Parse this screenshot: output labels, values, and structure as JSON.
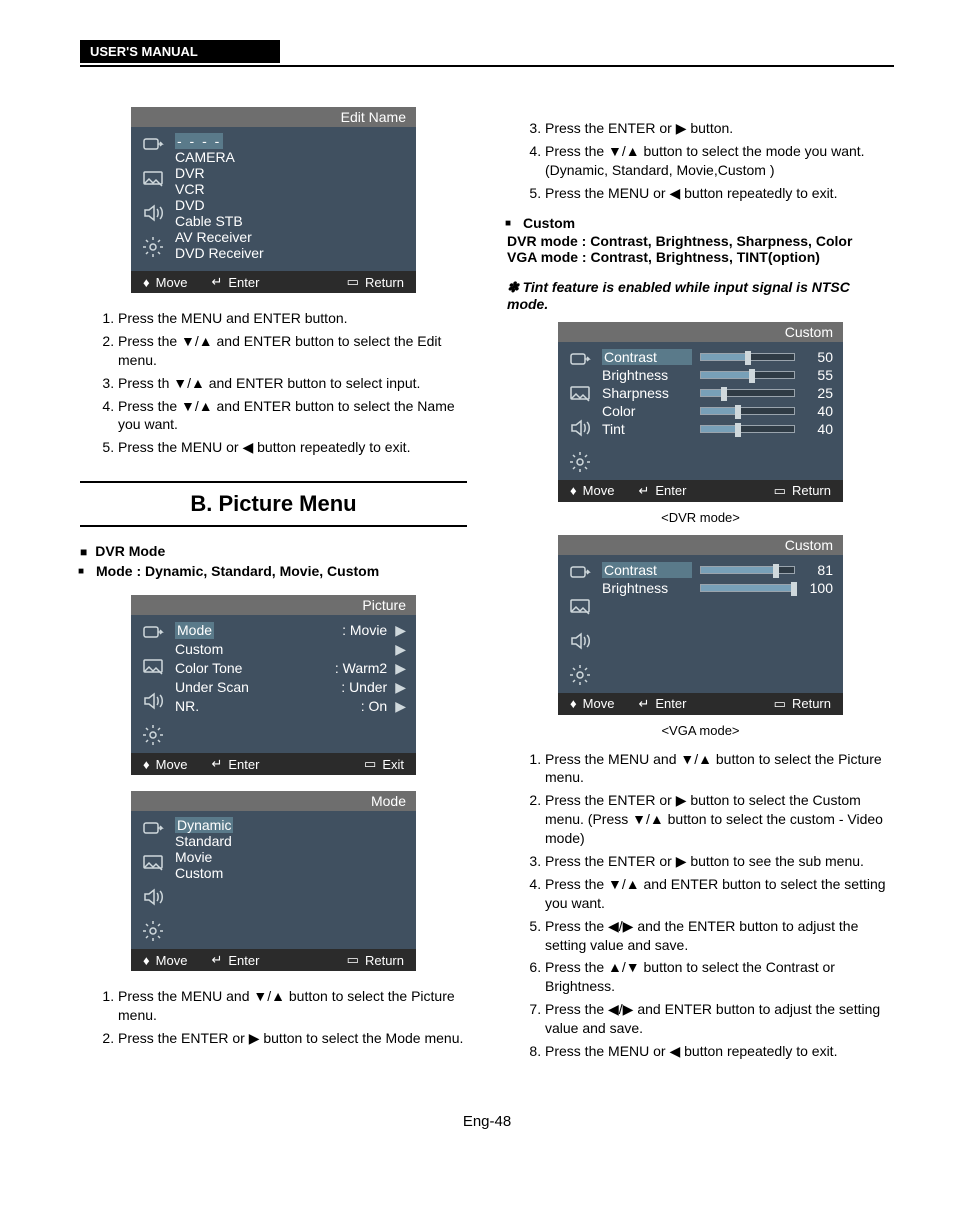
{
  "header": {
    "title": "USER'S MANUAL"
  },
  "osd_edit": {
    "title": "Edit Name",
    "dashes": "- - - -",
    "items": [
      "CAMERA",
      "DVR",
      "VCR",
      "DVD",
      "Cable STB",
      "AV Receiver",
      "DVD Receiver"
    ],
    "foot_move": "Move",
    "foot_enter": "Enter",
    "foot_return": "Return"
  },
  "steps_edit": [
    "Press the MENU and ENTER button.",
    "Press the ▼/▲ and ENTER button to select the Edit menu.",
    "Press th ▼/▲ and ENTER button to select input.",
    "Press the ▼/▲ and ENTER button to select the Name you want.",
    "Press the MENU or ◀ button repeatedly to exit."
  ],
  "section_b": "B. Picture Menu",
  "dvr_mode_hd": "DVR Mode",
  "mode_line": "Mode : Dynamic, Standard, Movie,  Custom",
  "osd_picture": {
    "title": "Picture",
    "rows": [
      {
        "lbl": "Mode",
        "val": ": Movie",
        "arr": "▶"
      },
      {
        "lbl": "Custom",
        "val": "",
        "arr": "▶"
      },
      {
        "lbl": "Color Tone",
        "val": ": Warm2",
        "arr": "▶"
      },
      {
        "lbl": "Under Scan",
        "val": ": Under",
        "arr": "▶"
      },
      {
        "lbl": "NR.",
        "val": ": On",
        "arr": "▶"
      }
    ],
    "foot_move": "Move",
    "foot_enter": "Enter",
    "foot_exit": "Exit"
  },
  "osd_mode": {
    "title": "Mode",
    "items": [
      "Dynamic",
      "Standard",
      "Movie",
      "Custom"
    ],
    "highlight_index": 0,
    "foot_move": "Move",
    "foot_enter": "Enter",
    "foot_return": "Return"
  },
  "steps_mode": [
    "Press the MENU and ▼/▲ button to select the Picture menu.",
    "Press  the ENTER or ▶ button to select the Mode menu."
  ],
  "right_top_steps": [
    "Press  the ENTER or ▶ button.",
    "Press the ▼/▲ button to select the mode you want. (Dynamic, Standard, Movie,Custom )",
    "Press the MENU or ◀ button repeatedly to exit."
  ],
  "custom_hd": "Custom",
  "dvr_line": "DVR mode : Contrast, Brightness, Sharpness, Color",
  "vga_line": "VGA mode   : Contrast, Brightness, TINT(option)",
  "tint_note": "✽ Tint feature is enabled while input signal is NTSC mode.",
  "osd_custom_dvr": {
    "title": "Custom",
    "rows": [
      {
        "lbl": "Contrast",
        "val": 50
      },
      {
        "lbl": "Brightness",
        "val": 55
      },
      {
        "lbl": "Sharpness",
        "val": 25
      },
      {
        "lbl": "Color",
        "val": 40
      },
      {
        "lbl": "Tint",
        "val": 40
      }
    ],
    "caption": "<DVR mode>",
    "foot_move": "Move",
    "foot_enter": "Enter",
    "foot_return": "Return"
  },
  "osd_custom_vga": {
    "title": "Custom",
    "rows": [
      {
        "lbl": "Contrast",
        "val": 81
      },
      {
        "lbl": "Brightness",
        "val": 100
      }
    ],
    "caption": "<VGA mode>",
    "foot_move": "Move",
    "foot_enter": "Enter",
    "foot_return": "Return"
  },
  "steps_custom": [
    "Press the MENU and ▼/▲ button to select the Picture menu.",
    "Press the ENTER or ▶ button to select the Custom menu. (Press ▼/▲ button to select the custom - Video mode)",
    "Press the ENTER or ▶ button to see the sub menu.",
    "Press the ▼/▲ and ENTER button to select the setting you want.",
    "Press the ◀/▶ and the ENTER button to adjust the setting value and save.",
    "Press the ▲/▼ button to select the Contrast or Brightness.",
    "Press the ◀/▶ and ENTER button to adjust the setting value and save.",
    "Press the MENU or ◀ button repeatedly to exit."
  ],
  "page": "Eng-48",
  "glyph": {
    "updown": "♦",
    "enter": "↵",
    "battery": "▭"
  }
}
